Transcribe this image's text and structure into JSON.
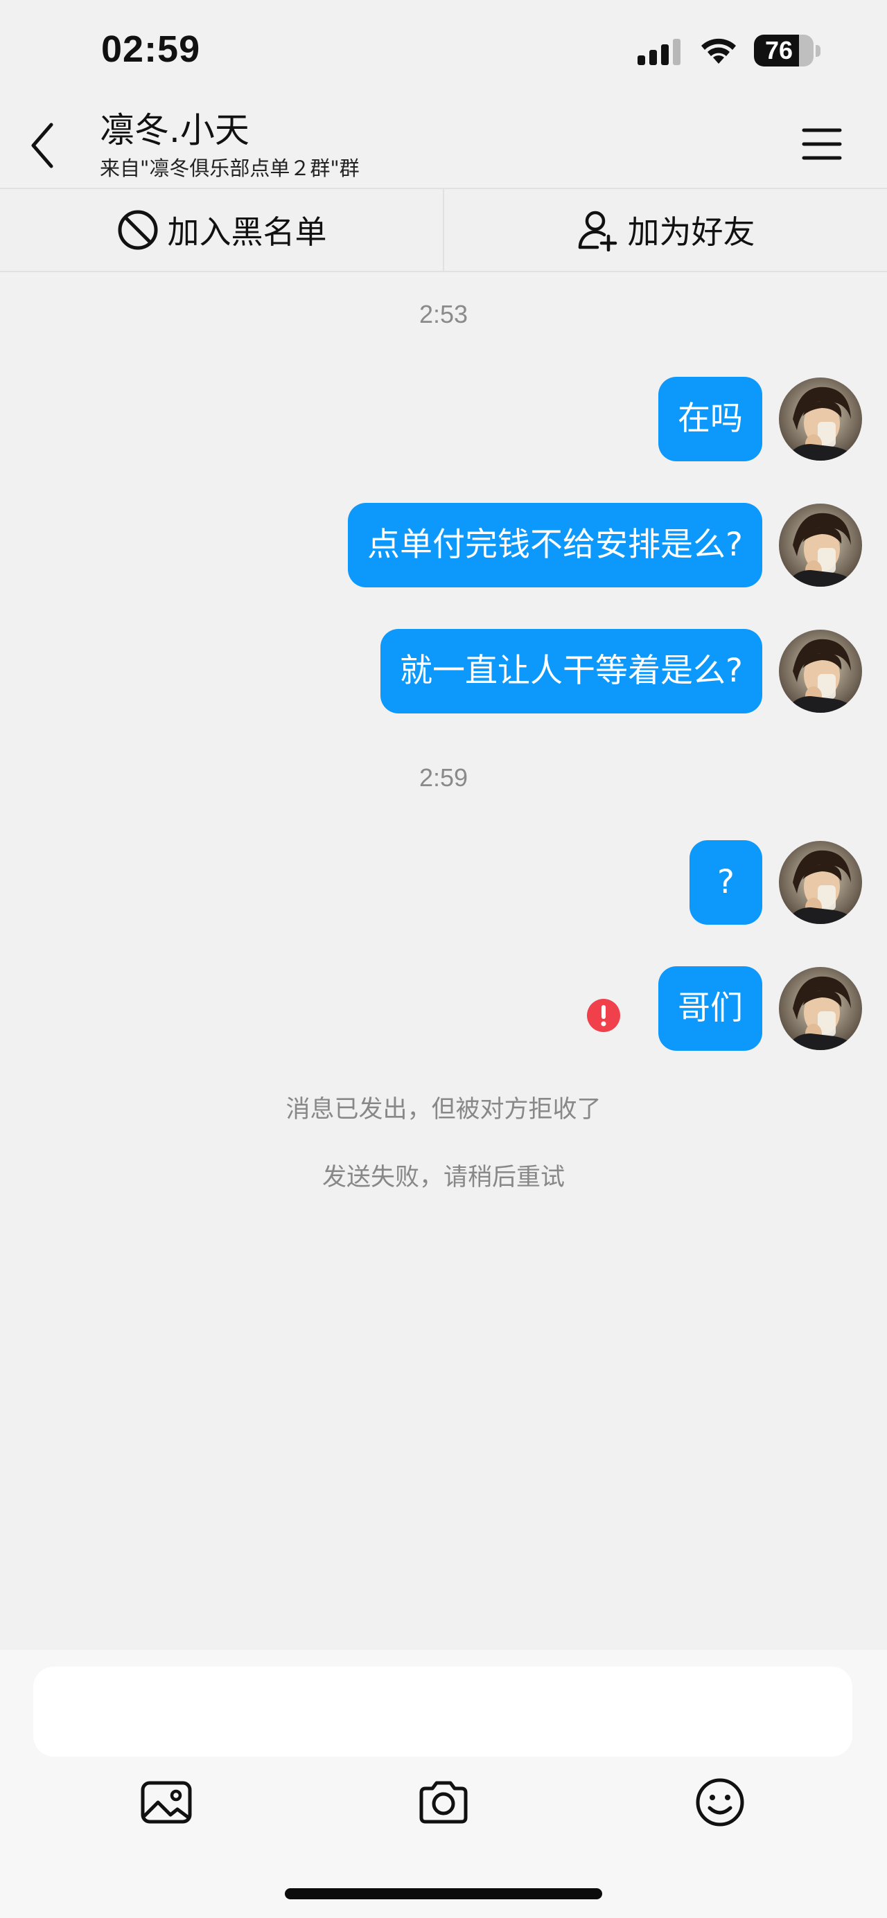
{
  "status_bar": {
    "time": "02:59",
    "battery_level": "76",
    "battery_fraction": 0.76
  },
  "header": {
    "contact_name": "凛冬.小天",
    "source": "来自\"凛冬俱乐部点单２群\"群",
    "icons": {
      "back": "back-chevron-icon",
      "menu": "menu-icon"
    }
  },
  "action_bar": {
    "blacklist_label": "加入黑名单",
    "add_friend_label": "加为好友",
    "icons": {
      "blacklist": "block-icon",
      "add_friend": "add-user-icon"
    }
  },
  "chat": {
    "timestamps": [
      "2:53",
      "2:59"
    ],
    "messages": [
      {
        "text": "在吗",
        "sender": "me",
        "status": "sent"
      },
      {
        "text": "点单付完钱不给安排是么?",
        "sender": "me",
        "status": "sent"
      },
      {
        "text": "就一直让人干等着是么?",
        "sender": "me",
        "status": "sent"
      },
      {
        "text": "?",
        "sender": "me",
        "status": "sent"
      },
      {
        "text": "哥们",
        "sender": "me",
        "status": "failed"
      }
    ],
    "system_notes": [
      "消息已发出，但被对方拒收了",
      "发送失败，请稍后重试"
    ]
  },
  "composer": {
    "input_value": "",
    "tools": [
      "image-icon",
      "camera-icon",
      "emoji-icon"
    ]
  },
  "colors": {
    "bubble": "#0c99fb",
    "error": "#f0404c",
    "background": "#f1f1f2"
  }
}
